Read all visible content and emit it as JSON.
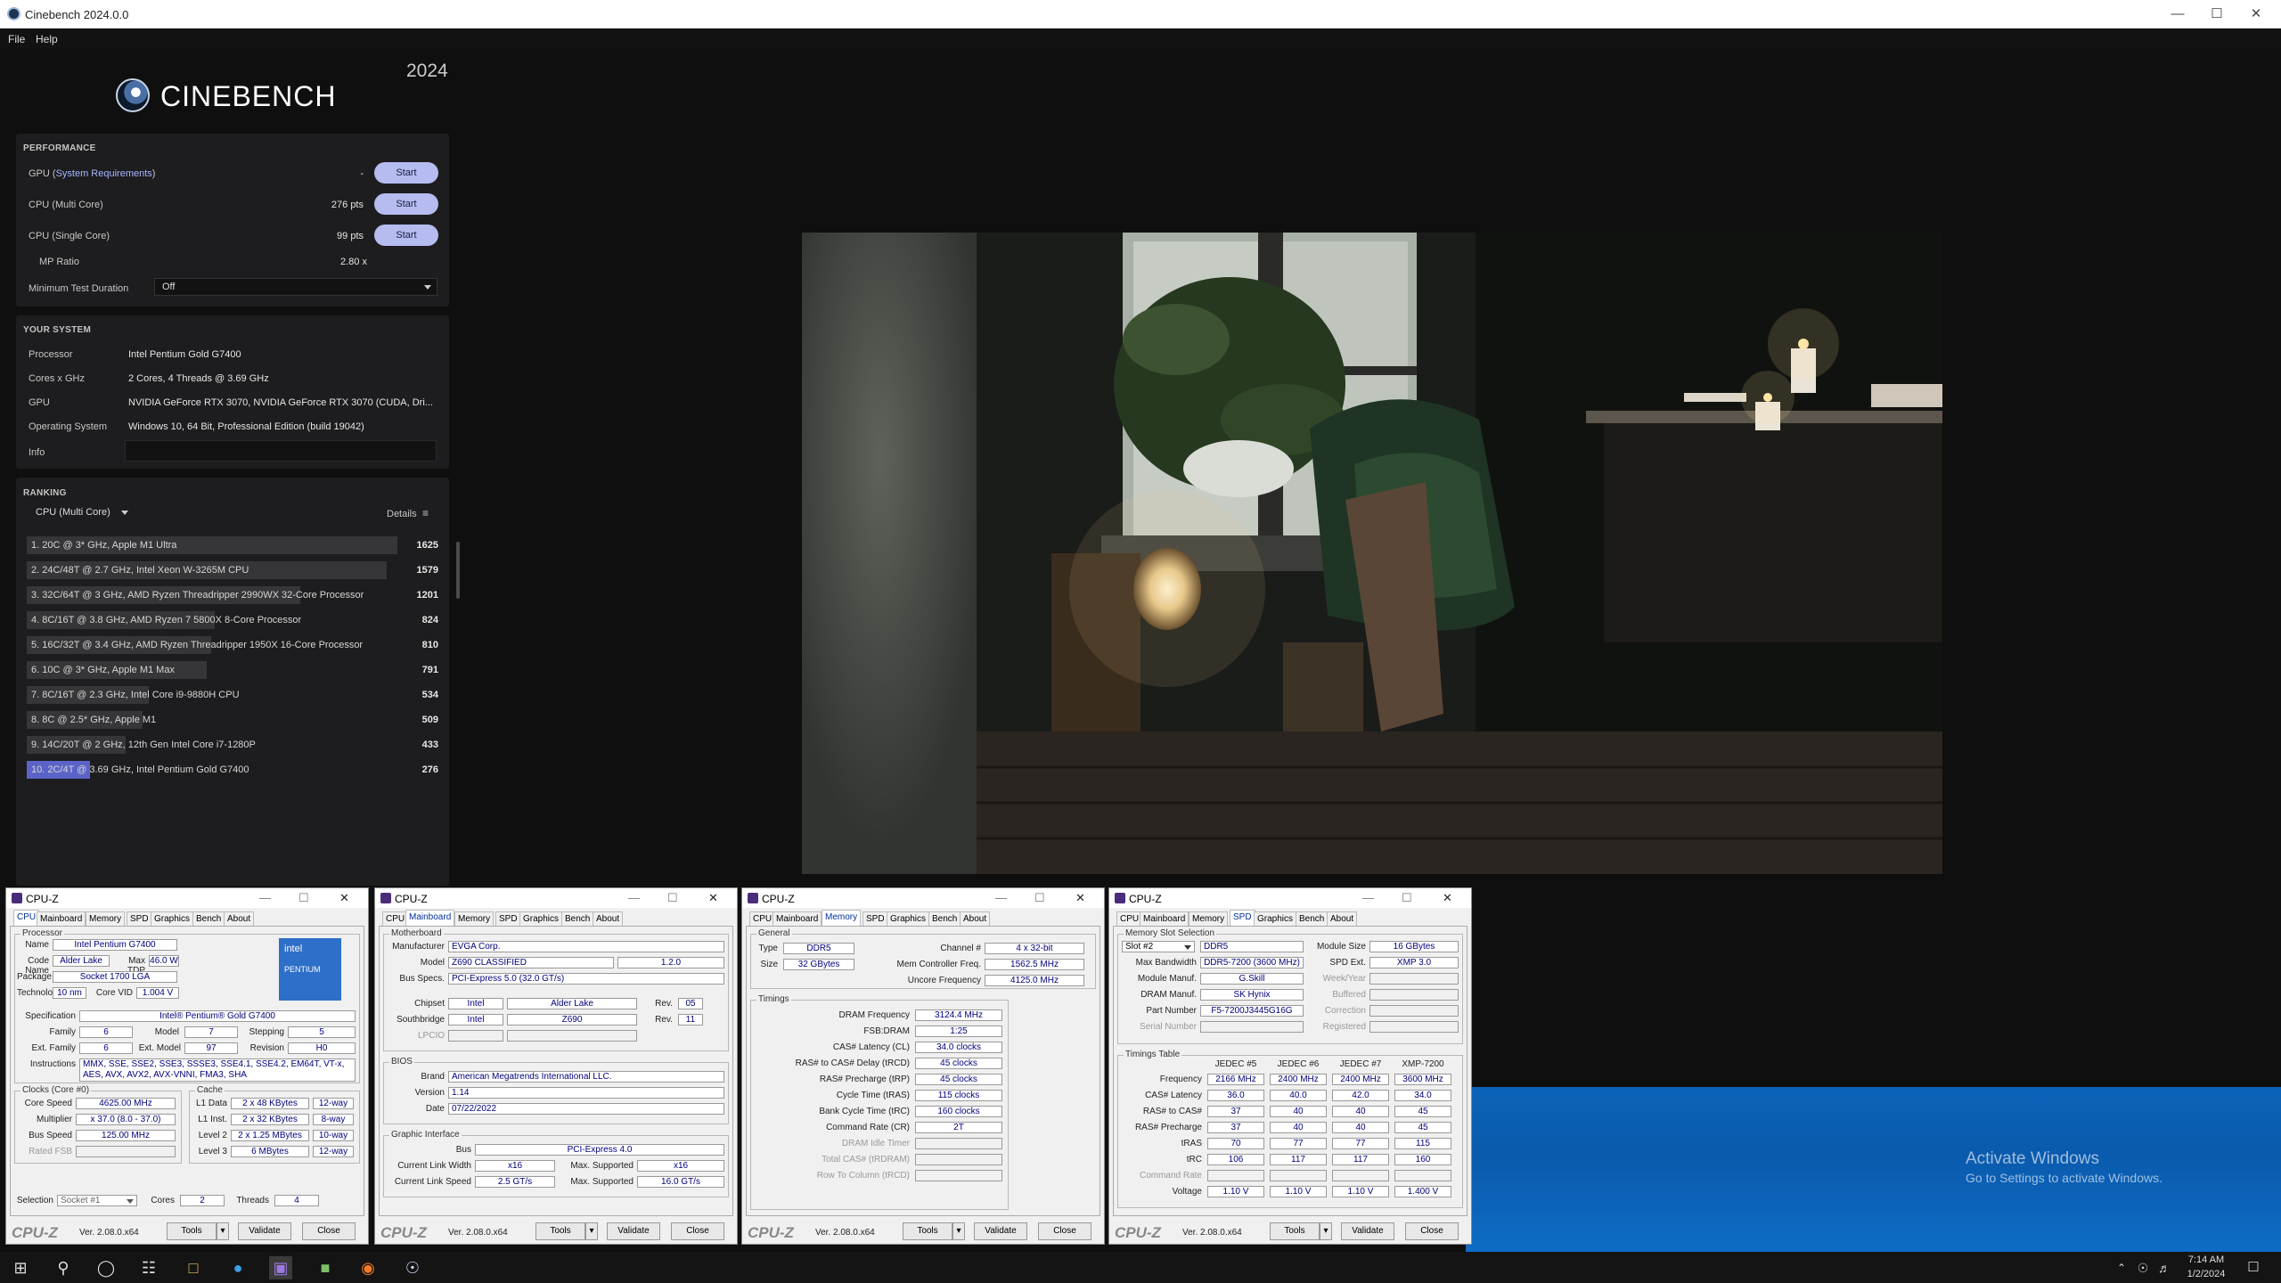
{
  "window": {
    "title": "Cinebench 2024.0.0"
  },
  "menu": [
    "File",
    "Help"
  ],
  "brand": {
    "name": "CINEBENCH",
    "year": "2024"
  },
  "performance": {
    "title": "PERFORMANCE",
    "rows": [
      {
        "label_pre": "GPU (",
        "label_link": "System Requirements",
        "label_post": ")",
        "score": "-",
        "button": "Start"
      },
      {
        "label": "CPU (Multi Core)",
        "score": "276 pts",
        "button": "Start"
      },
      {
        "label": "CPU (Single Core)",
        "score": "99 pts",
        "button": "Start"
      }
    ],
    "mp_label": "MP Ratio",
    "mp_value": "2.80 x",
    "min_label": "Minimum Test Duration",
    "min_value": "Off"
  },
  "system": {
    "title": "YOUR SYSTEM",
    "rows": [
      {
        "label": "Processor",
        "value": "Intel Pentium Gold G7400"
      },
      {
        "label": "Cores x GHz",
        "value": "2 Cores, 4 Threads @ 3.69 GHz"
      },
      {
        "label": "GPU",
        "value": "NVIDIA GeForce RTX 3070, NVIDIA GeForce RTX 3070 (CUDA, Dri..."
      },
      {
        "label": "Operating System",
        "value": "Windows 10, 64 Bit, Professional Edition (build 19042)"
      }
    ],
    "info_label": "Info"
  },
  "ranking": {
    "title": "RANKING",
    "select": "CPU (Multi Core)",
    "details": "Details",
    "items": [
      {
        "name": "1. 20C @ 3* GHz, Apple M1 Ultra",
        "score": "1625",
        "v": 1625
      },
      {
        "name": "2. 24C/48T @ 2.7 GHz, Intel Xeon W-3265M CPU",
        "score": "1579",
        "v": 1579
      },
      {
        "name": "3. 32C/64T @ 3 GHz, AMD Ryzen Threadripper 2990WX 32-Core Processor",
        "score": "1201",
        "v": 1201
      },
      {
        "name": "4. 8C/16T @ 3.8 GHz, AMD Ryzen 7 5800X 8-Core Processor",
        "score": "824",
        "v": 824
      },
      {
        "name": "5. 16C/32T @ 3.4 GHz, AMD Ryzen Threadripper 1950X 16-Core Processor",
        "score": "810",
        "v": 810
      },
      {
        "name": "6. 10C @ 3* GHz, Apple M1 Max",
        "score": "791",
        "v": 791
      },
      {
        "name": "7. 8C/16T @ 2.3 GHz, Intel Core i9-9880H CPU",
        "score": "534",
        "v": 534
      },
      {
        "name": "8. 8C @ 2.5* GHz, Apple M1",
        "score": "509",
        "v": 509
      },
      {
        "name": "9. 14C/20T @ 2 GHz, 12th Gen Intel Core i7-1280P",
        "score": "433",
        "v": 433
      },
      {
        "name": "10. 2C/4T @ 3.69 GHz, Intel Pentium Gold G7400",
        "score": "276",
        "v": 276,
        "current": true
      }
    ]
  },
  "watermark": {
    "line1": "Activate Windows",
    "line2": "Go to Settings to activate Windows."
  },
  "taskbar": {
    "time": "7:14 AM",
    "date": "1/2/2024"
  },
  "cpuz": {
    "title": "CPU-Z",
    "tabs": [
      "CPU",
      "Mainboard",
      "Memory",
      "SPD",
      "Graphics",
      "Bench",
      "About"
    ],
    "logo": "CPU-Z",
    "version": "Ver. 2.08.0.x64",
    "tools": "Tools",
    "validate": "Validate",
    "close": "Close",
    "cpu": {
      "processor": "Processor",
      "name_l": "Name",
      "name": "Intel Pentium G7400",
      "code_l": "Code Name",
      "code": "Alder Lake",
      "tdp_l": "Max TDP",
      "tdp": "46.0 W",
      "pkg_l": "Package",
      "pkg": "Socket 1700 LGA",
      "tech_l": "Technology",
      "tech": "10 nm",
      "vid_l": "Core VID",
      "vid": "1.004 V",
      "spec_l": "Specification",
      "spec": "Intel® Pentium® Gold G7400",
      "fam_l": "Family",
      "fam": "6",
      "mod_l": "Model",
      "mod": "7",
      "step_l": "Stepping",
      "step": "5",
      "efam_l": "Ext. Family",
      "efam": "6",
      "emod_l": "Ext. Model",
      "emod": "97",
      "rev_l": "Revision",
      "rev": "H0",
      "ins_l": "Instructions",
      "ins": "MMX, SSE, SSE2, SSE3, SSSE3, SSE4.1, SSE4.2, EM64T, VT-x, AES, AVX, AVX2, AVX-VNNI, FMA3, SHA",
      "clocks": "Clocks (Core #0)",
      "cs_l": "Core Speed",
      "cs": "4625.00 MHz",
      "mul_l": "Multiplier",
      "mul": "x 37.0 (8.0 - 37.0)",
      "bus_l": "Bus Speed",
      "bus": "125.00 MHz",
      "fsb_l": "Rated FSB",
      "cache": "Cache",
      "l1d_l": "L1 Data",
      "l1d": "2 x 48 KBytes",
      "l1d_w": "12-way",
      "l1i_l": "L1 Inst.",
      "l1i": "2 x 32 KBytes",
      "l1i_w": "8-way",
      "l2_l": "Level 2",
      "l2": "2 x 1.25 MBytes",
      "l2_w": "10-way",
      "l3_l": "Level 3",
      "l3": "6 MBytes",
      "l3_w": "12-way",
      "sel_l": "Selection",
      "sel": "Socket #1",
      "cores_l": "Cores",
      "cores": "2",
      "thr_l": "Threads",
      "thr": "4",
      "badge1": "intel",
      "badge2": "PENTIUM"
    },
    "mb": {
      "motherboard": "Motherboard",
      "man_l": "Manufacturer",
      "man": "EVGA Corp.",
      "model_l": "Model",
      "model": "Z690 CLASSIFIED",
      "model_rev": "1.2.0",
      "bus_l": "Bus Specs.",
      "bus": "PCI-Express 5.0 (32.0 GT/s)",
      "chip_l": "Chipset",
      "chip_v": "Intel",
      "chip_n": "Alder Lake",
      "rev_l": "Rev.",
      "chip_rev": "05",
      "sb_l": "Southbridge",
      "sb_v": "Intel",
      "sb_n": "Z690",
      "sb_rev": "11",
      "lpc_l": "LPCIO",
      "bios": "BIOS",
      "brand_l": "Brand",
      "brand": "American Megatrends International LLC.",
      "ver_l": "Version",
      "ver": "1.14",
      "date_l": "Date",
      "date": "07/22/2022",
      "gi": "Graphic Interface",
      "gbus_l": "Bus",
      "gbus": "PCI-Express 4.0",
      "clw_l": "Current Link Width",
      "clw": "x16",
      "msw_l": "Max. Supported",
      "msw": "x16",
      "cls_l": "Current Link Speed",
      "cls": "2.5 GT/s",
      "mss_l": "Max. Supported",
      "mss": "16.0 GT/s"
    },
    "mem": {
      "general": "General",
      "type_l": "Type",
      "type": "DDR5",
      "ch_l": "Channel #",
      "ch": "4 x 32-bit",
      "size_l": "Size",
      "size": "32 GBytes",
      "mcf_l": "Mem Controller Freq.",
      "mcf": "1562.5 MHz",
      "ucf_l": "Uncore Frequency",
      "ucf": "4125.0 MHz",
      "timings": "Timings",
      "rows": [
        {
          "l": "DRAM Frequency",
          "v": "3124.4 MHz"
        },
        {
          "l": "FSB:DRAM",
          "v": "1:25"
        },
        {
          "l": "CAS# Latency (CL)",
          "v": "34.0 clocks"
        },
        {
          "l": "RAS# to CAS# Delay (tRCD)",
          "v": "45 clocks"
        },
        {
          "l": "RAS# Precharge (tRP)",
          "v": "45 clocks"
        },
        {
          "l": "Cycle Time (tRAS)",
          "v": "115 clocks"
        },
        {
          "l": "Bank Cycle Time (tRC)",
          "v": "160 clocks"
        },
        {
          "l": "Command Rate (CR)",
          "v": "2T"
        },
        {
          "l": "DRAM Idle Timer",
          "v": "",
          "g": true
        },
        {
          "l": "Total CAS# (tRDRAM)",
          "v": "",
          "g": true
        },
        {
          "l": "Row To Column (tRCD)",
          "v": "",
          "g": true
        }
      ]
    },
    "spd": {
      "mss": "Memory Slot Selection",
      "slot": "Slot #2",
      "slot_type": "DDR5",
      "msize_l": "Module Size",
      "msize": "16 GBytes",
      "mb_l": "Max Bandwidth",
      "mb": "DDR5-7200 (3600 MHz)",
      "ext_l": "SPD Ext.",
      "ext": "XMP 3.0",
      "mm_l": "Module Manuf.",
      "mm": "G.Skill",
      "wy_l": "Week/Year",
      "dm_l": "DRAM Manuf.",
      "dm": "SK Hynix",
      "buf_l": "Buffered",
      "pn_l": "Part Number",
      "pn": "F5-7200J3445G16G",
      "cor_l": "Correction",
      "sn_l": "Serial Number",
      "reg_l": "Registered",
      "tt": "Timings Table",
      "cols": [
        "JEDEC #5",
        "JEDEC #6",
        "JEDEC #7",
        "XMP-7200"
      ],
      "rows": [
        {
          "l": "Frequency",
          "v": [
            "2166 MHz",
            "2400 MHz",
            "2400 MHz",
            "3600 MHz"
          ]
        },
        {
          "l": "CAS# Latency",
          "v": [
            "36.0",
            "40.0",
            "42.0",
            "34.0"
          ]
        },
        {
          "l": "RAS# to CAS#",
          "v": [
            "37",
            "40",
            "40",
            "45"
          ]
        },
        {
          "l": "RAS# Precharge",
          "v": [
            "37",
            "40",
            "40",
            "45"
          ]
        },
        {
          "l": "tRAS",
          "v": [
            "70",
            "77",
            "77",
            "115"
          ]
        },
        {
          "l": "tRC",
          "v": [
            "106",
            "117",
            "117",
            "160"
          ]
        },
        {
          "l": "Command Rate",
          "v": [
            "",
            "",
            "",
            ""
          ],
          "g": true
        },
        {
          "l": "Voltage",
          "v": [
            "1.10 V",
            "1.10 V",
            "1.10 V",
            "1.400 V"
          ]
        }
      ]
    }
  }
}
